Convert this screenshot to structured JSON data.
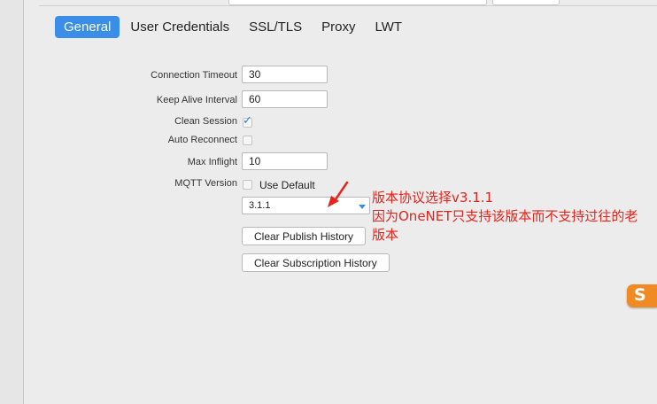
{
  "tabs": {
    "general": "General",
    "user_credentials": "User Credentials",
    "ssl_tls": "SSL/TLS",
    "proxy": "Proxy",
    "lwt": "LWT"
  },
  "active_tab": "General",
  "form": {
    "connection_timeout": {
      "label": "Connection Timeout",
      "value": "30"
    },
    "keep_alive_interval": {
      "label": "Keep Alive Interval",
      "value": "60"
    },
    "clean_session": {
      "label": "Clean Session",
      "checked": true
    },
    "auto_reconnect": {
      "label": "Auto Reconnect",
      "checked": false
    },
    "max_inflight": {
      "label": "Max Inflight",
      "value": "10"
    },
    "mqtt_version": {
      "label": "MQTT Version",
      "use_default_label": "Use Default",
      "use_default_checked": false,
      "selected": "3.1.1"
    }
  },
  "buttons": {
    "clear_publish_history": "Clear Publish History",
    "clear_subscription_history": "Clear Subscription History"
  },
  "annotation": {
    "line1": "版本协议选择v3.1.1",
    "line2": "因为OneNET只支持该版本而不支持过往的老",
    "line3": "版本"
  },
  "colors": {
    "accent": "#3b8ee8",
    "annotation": "#e5231b",
    "ime": "#f08a24"
  },
  "icons": {
    "check": "checkmark-icon",
    "dropdown": "caret-down-icon",
    "ime": "sogou-s-icon"
  }
}
